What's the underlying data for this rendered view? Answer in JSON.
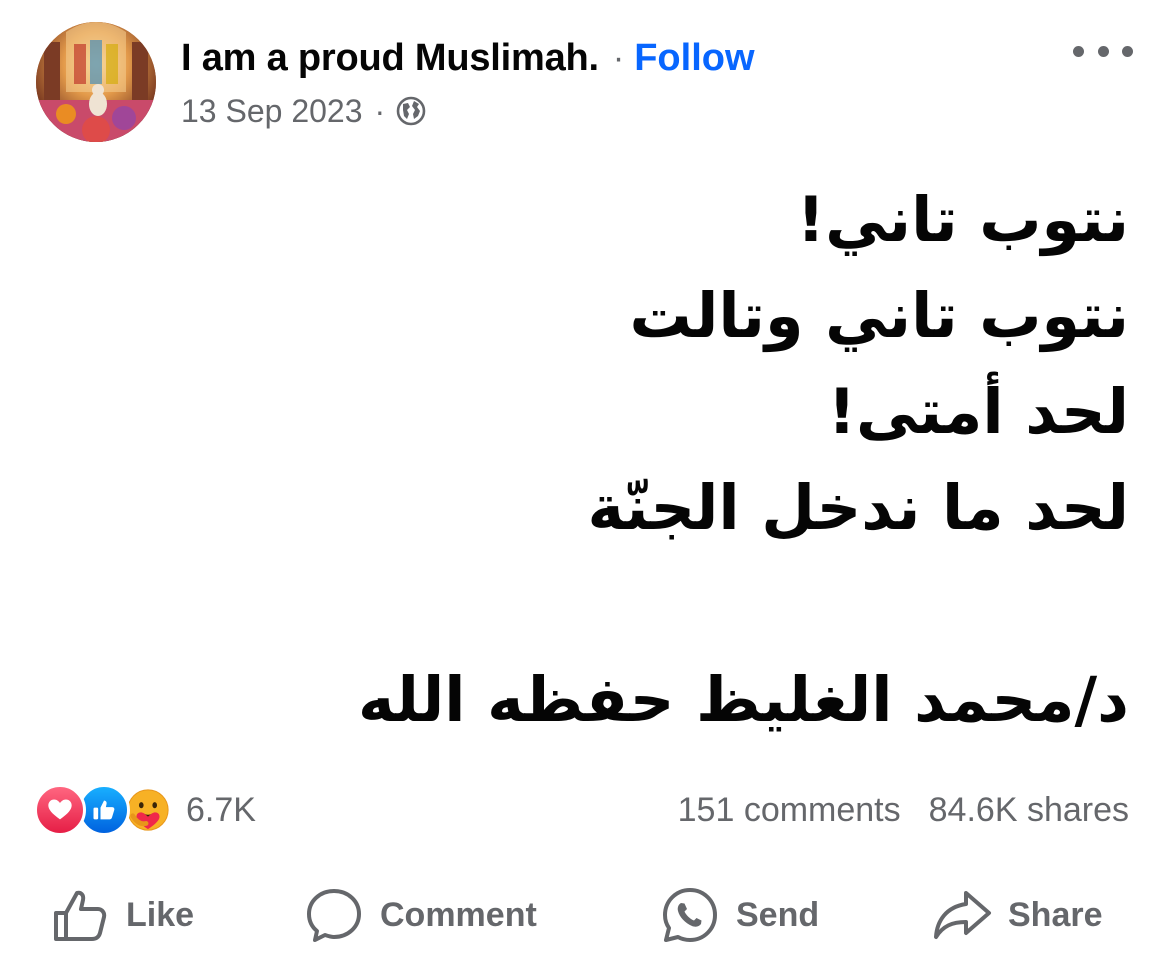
{
  "post": {
    "author": "I am a proud Muslimah.",
    "separator": "·",
    "follow_label": "Follow",
    "date": "13 Sep 2023",
    "meta_separator": "·",
    "audience_icon": "globe-icon",
    "more_icon": "more-horizontal-icon",
    "text_lines": [
      "نتوب تاني!",
      "نتوب تاني وتالت",
      "لحد أمتى!",
      "لحد ما ندخل الجنّة",
      "",
      "د/محمد الغليظ حفظه الله"
    ]
  },
  "reactions": {
    "icons": [
      "love-reaction-icon",
      "like-reaction-icon",
      "care-reaction-icon"
    ],
    "count": "6.7K"
  },
  "stats": {
    "comments": "151 comments",
    "shares": "84.6K shares"
  },
  "actions": {
    "like": "Like",
    "comment": "Comment",
    "send": "Send",
    "share": "Share"
  },
  "colors": {
    "text": "#050505",
    "secondary": "#65676b",
    "follow": "#0866ff",
    "love": "#f0284a",
    "like": "#0866ff"
  }
}
